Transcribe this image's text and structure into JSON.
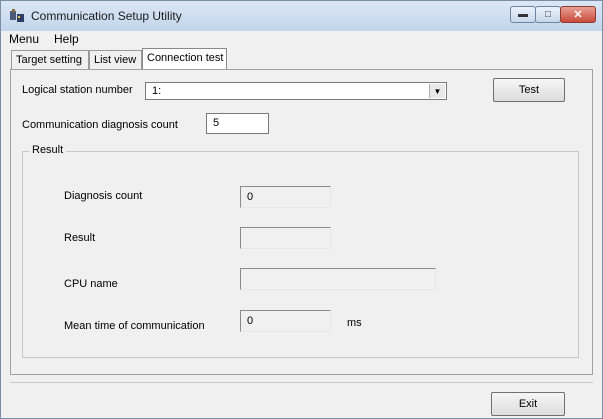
{
  "window": {
    "title": "Communication Setup Utility"
  },
  "menu": {
    "items": [
      "Menu",
      "Help"
    ]
  },
  "tabs": [
    {
      "label": "Target setting"
    },
    {
      "label": "List view"
    },
    {
      "label": "Connection test",
      "active": true
    }
  ],
  "form": {
    "logical_station_label": "Logical station number",
    "logical_station_value": "1:",
    "test_button": "Test",
    "diag_count_label": "Communication diagnosis count",
    "diag_count_value": "5"
  },
  "result": {
    "group_title": "Result",
    "diagnosis_count_label": "Diagnosis count",
    "diagnosis_count_value": "0",
    "result_label": "Result",
    "result_value": "",
    "cpu_name_label": "CPU name",
    "cpu_name_value": "",
    "mean_time_label": "Mean time of communication",
    "mean_time_value": "0",
    "mean_time_unit": "ms"
  },
  "footer": {
    "exit_button": "Exit"
  },
  "colors": {
    "titlebar": "#c3d5ec",
    "close_button": "#c94a3a",
    "window_bg": "#f0f0f0"
  },
  "icons": [
    "app-icon",
    "minimize-icon",
    "maximize-icon",
    "close-icon",
    "dropdown-arrow-icon"
  ]
}
